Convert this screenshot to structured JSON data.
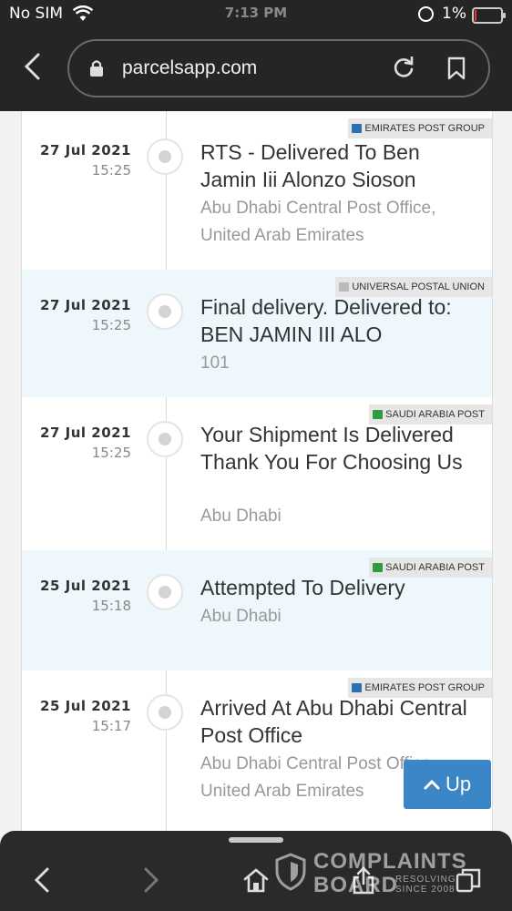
{
  "status_bar": {
    "carrier": "No SIM",
    "time": "7:13 PM",
    "battery": "1%",
    "battery_level": 0.01
  },
  "browser": {
    "url": "parcelsapp.com"
  },
  "events": [
    {
      "date": "27 Jul 2021",
      "time": "15:25",
      "status": "RTS - Delivered To Ben Jamin Iii Alonzo Sioson",
      "location": "Abu Dhabi Central Post Office, United Arab Emirates",
      "source": "EMIRATES POST GROUP",
      "source_color": "#2a6fb0"
    },
    {
      "date": "27 Jul 2021",
      "time": "15:25",
      "status": "Final delivery. Delivered to: BEN JAMIN III ALO",
      "location": "101",
      "source": "UNIVERSAL POSTAL UNION",
      "source_color": "#bbbbbb"
    },
    {
      "date": "27 Jul 2021",
      "time": "15:25",
      "status": "Your Shipment Is Delivered Thank You For Choosing Us",
      "location": "Abu Dhabi",
      "source": "SAUDI ARABIA POST",
      "source_color": "#2f9a3e"
    },
    {
      "date": "25 Jul 2021",
      "time": "15:18",
      "status": "Attempted To Delivery",
      "location": "Abu Dhabi",
      "source": "SAUDI ARABIA POST",
      "source_color": "#2f9a3e"
    },
    {
      "date": "25 Jul 2021",
      "time": "15:17",
      "status": "Arrived At Abu Dhabi Central Post Office",
      "location": "Abu Dhabi Central Post Office, United Arab Emirates",
      "source": "EMIRATES POST GROUP",
      "source_color": "#2a6fb0"
    }
  ],
  "up_button": {
    "label": "Up"
  },
  "watermark": {
    "line1": "COMPLAINTS",
    "line2": "BOARD",
    "tag1": "RESOLVING",
    "tag2": "SINCE 2008"
  }
}
